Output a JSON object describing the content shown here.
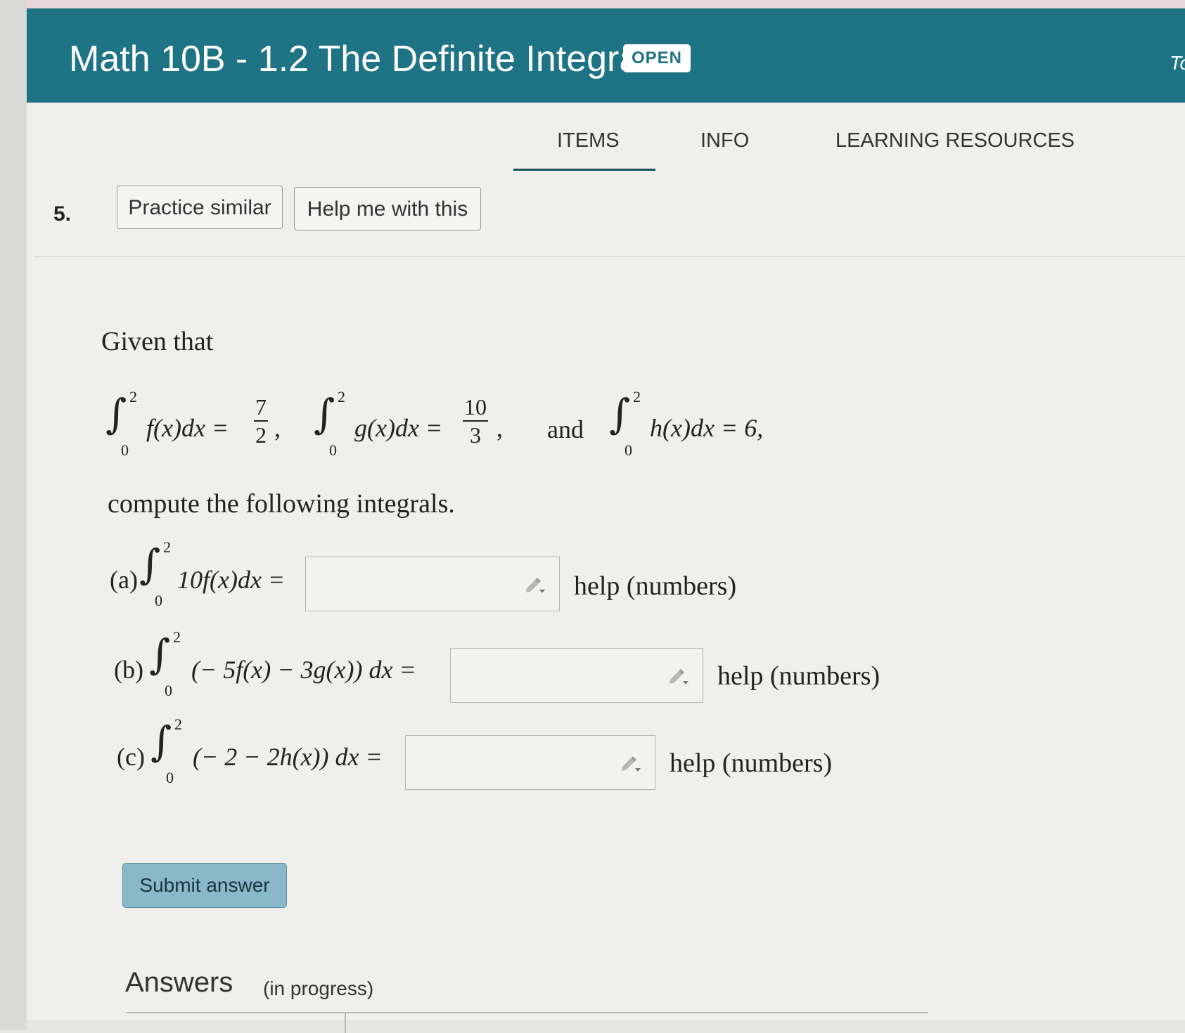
{
  "header": {
    "title": "Math 10B - 1.2 The Definite Integral",
    "badge": "OPEN",
    "truncated_text": "To"
  },
  "tabs": [
    {
      "label": "ITEMS",
      "active": true
    },
    {
      "label": "INFO",
      "active": false
    },
    {
      "label": "LEARNING RESOURCES",
      "active": false
    }
  ],
  "question": {
    "number": "5.",
    "practice_label": "Practice similar",
    "help_label": "Help me with this",
    "intro": "Given that",
    "given": {
      "lower": "0",
      "upper": "2",
      "f_integrand": "f(x)dx =",
      "f_num": "7",
      "f_den": "2",
      "g_integrand": "g(x)dx =",
      "g_num": "10",
      "g_den": "3",
      "and": "and",
      "h_integrand": "h(x)dx = 6,"
    },
    "instruction": "compute the following integrals.",
    "parts": [
      {
        "label": "(a)",
        "expr": "10f(x)dx =",
        "value": "",
        "help": "help (numbers)"
      },
      {
        "label": "(b)",
        "expr": "(− 5f(x) − 3g(x)) dx =",
        "value": "",
        "help": "help (numbers)"
      },
      {
        "label": "(c)",
        "expr": "(− 2 − 2h(x)) dx =",
        "value": "",
        "help": "help (numbers)"
      }
    ]
  },
  "submit_label": "Submit answer",
  "answers": {
    "title": "Answers",
    "status": "(in progress)"
  },
  "colors": {
    "header_bg": "#1e7385",
    "submit_bg": "#88b8ca",
    "page_bg": "#efefec"
  }
}
